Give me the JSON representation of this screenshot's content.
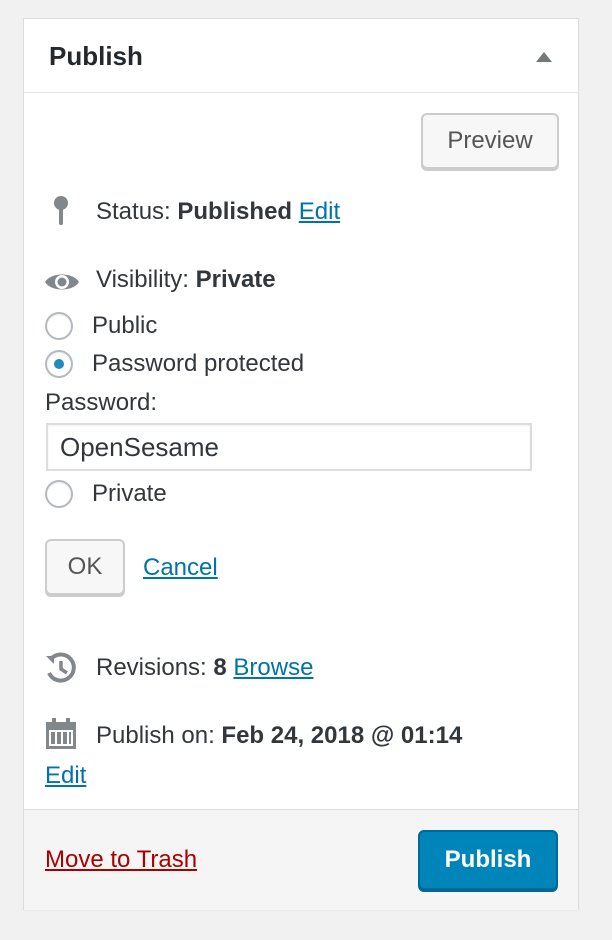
{
  "header": {
    "title": "Publish",
    "toggle_icon": "arrow-up-icon"
  },
  "preview_label": "Preview",
  "status": {
    "label": "Status:",
    "value": "Published",
    "edit": "Edit",
    "icon": "pin-icon"
  },
  "visibility": {
    "label": "Visibility:",
    "value": "Private",
    "icon": "eye-icon",
    "options": [
      {
        "label": "Public",
        "checked": false
      },
      {
        "label": "Password protected",
        "checked": true
      },
      {
        "label": "Private",
        "checked": false
      }
    ],
    "password_label": "Password:",
    "password_value": "OpenSesame",
    "ok_label": "OK",
    "cancel_label": "Cancel"
  },
  "revisions": {
    "label": "Revisions:",
    "count": "8",
    "browse": "Browse",
    "icon": "history-icon"
  },
  "publish_on": {
    "label": "Publish on:",
    "date": "Feb 24, 2018 @ 01:14",
    "edit": "Edit",
    "icon": "calendar-icon"
  },
  "footer": {
    "trash_label": "Move to Trash",
    "publish_label": "Publish"
  },
  "colors": {
    "accent": "#0085ba",
    "link": "#0073aa",
    "danger": "#a00",
    "icon": "#82878c"
  }
}
